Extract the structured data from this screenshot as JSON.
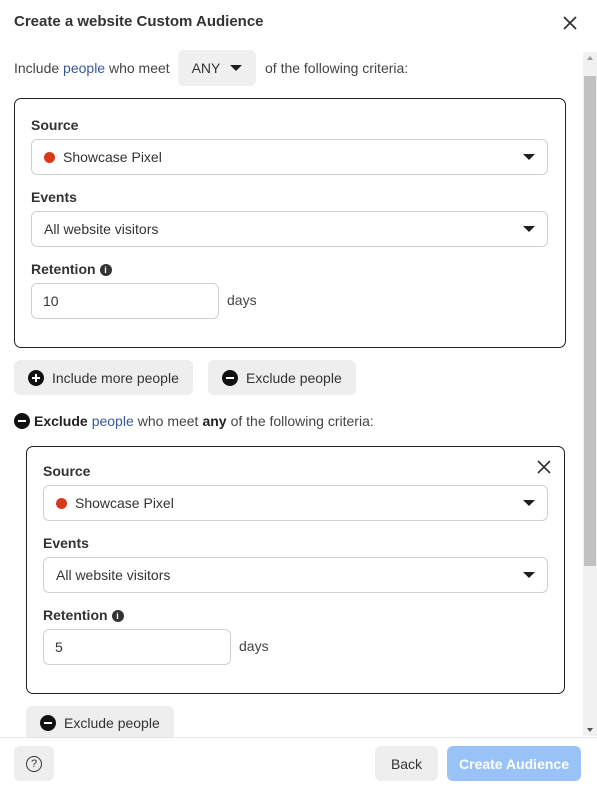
{
  "dialog": {
    "title": "Create a website Custom Audience",
    "close_icon": "close-icon"
  },
  "include": {
    "prefix": "Include",
    "people_link": "people",
    "middle": "who meet",
    "match_value": "ANY",
    "suffix": "of the following criteria:",
    "source_label": "Source",
    "source_value": "Showcase Pixel",
    "source_color": "#d8391b",
    "events_label": "Events",
    "events_value": "All website visitors",
    "retention_label": "Retention",
    "retention_value": "10",
    "retention_unit": "days"
  },
  "actions": {
    "include_more": "Include more people",
    "exclude": "Exclude people"
  },
  "exclude": {
    "prefix": "Exclude",
    "people_link": "people",
    "middle": "who meet",
    "match_value": "any",
    "suffix": "of the following criteria:",
    "source_label": "Source",
    "source_value": "Showcase Pixel",
    "events_label": "Events",
    "events_value": "All website visitors",
    "retention_label": "Retention",
    "retention_value": "5",
    "retention_unit": "days",
    "exclude_button": "Exclude people"
  },
  "footer": {
    "help_icon": "?",
    "back": "Back",
    "create": "Create Audience",
    "create_color": "#99c3f6"
  }
}
